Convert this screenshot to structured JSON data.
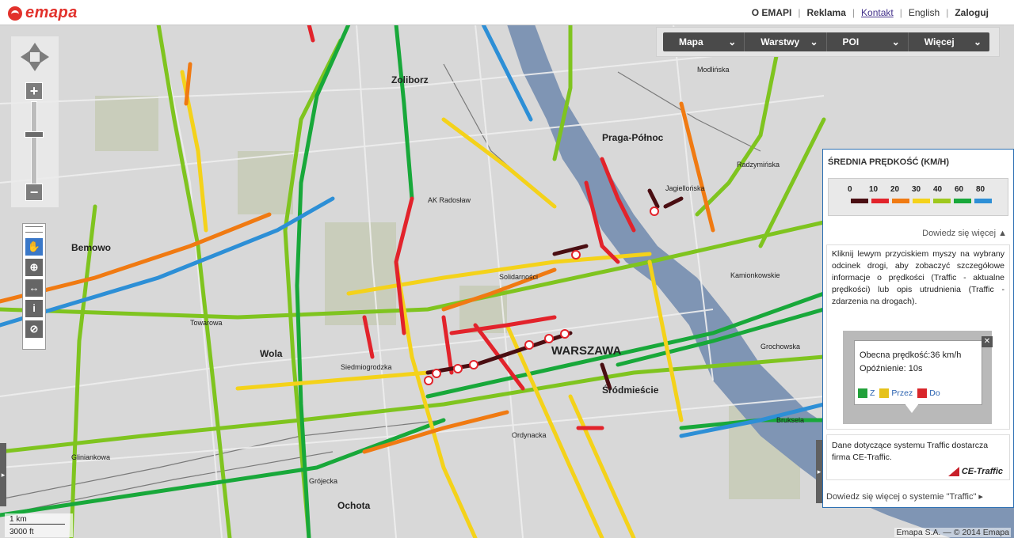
{
  "header": {
    "logo": "emapa",
    "links": [
      {
        "label": "O EMAPI",
        "style": "bold"
      },
      {
        "label": "Reklama",
        "style": "bold"
      },
      {
        "label": "Kontakt",
        "style": "active"
      },
      {
        "label": "English",
        "style": "normal"
      },
      {
        "label": "Zaloguj",
        "style": "bold"
      }
    ]
  },
  "menu": {
    "items": [
      "Mapa",
      "Warstwy",
      "POI",
      "Więcej"
    ]
  },
  "map_labels": [
    "Zoliborz",
    "Praga-Północ",
    "WARSZAWA",
    "Wola",
    "Śródmieście",
    "Ochota",
    "Bemowo",
    "Kamionkowskie",
    "Bruksela",
    "Gliniankowa",
    "Siedmiogrodzka",
    "Grójecka",
    "Ordynacka",
    "AK Radosław",
    "Jagiellońska",
    "Modlińska",
    "Solidarności",
    "Towarowa",
    "Radzymińska",
    "Grochowska"
  ],
  "scale": {
    "metric": "1 km",
    "imperial": "3000 ft"
  },
  "traffic_panel": {
    "title": "ŚREDNIA PRĘDKOŚĆ (KM/H)",
    "legend_values": [
      "0",
      "10",
      "20",
      "30",
      "40",
      "60",
      "80"
    ],
    "legend_colors": [
      "#4a0e12",
      "#e2232b",
      "#f07a12",
      "#f4d21a",
      "#9ec81d",
      "#18a83a",
      "#2d8fd6"
    ],
    "more_label": "Dowiedz się więcej ▲",
    "instructions": "Kliknij lewym przyciskiem myszy na wybrany odcinek drogi, aby zobaczyć szczegółowe informacje o prędkości (Traffic - aktualne prędkości) lub opis utrudnienia (Traffic - zdarzenia na drogach).",
    "popup": {
      "speed": "Obecna prędkość:36 km/h",
      "delay": "Opóźnienie: 10s",
      "actions": [
        {
          "label": "Z",
          "color": "#22a13a"
        },
        {
          "label": "Przez",
          "color": "#e6c21a"
        },
        {
          "label": "Do",
          "color": "#d9262a"
        }
      ]
    },
    "source_text": "Dane dotyczące systemu Traffic dostarcza firma CE-Traffic.",
    "source_logo": "CE-Traffic",
    "more_system": "Dowiedz się więcej o systemie \"Traffic\" ▸"
  },
  "copyright": "Emapa S.A. — © 2014 Emapa"
}
